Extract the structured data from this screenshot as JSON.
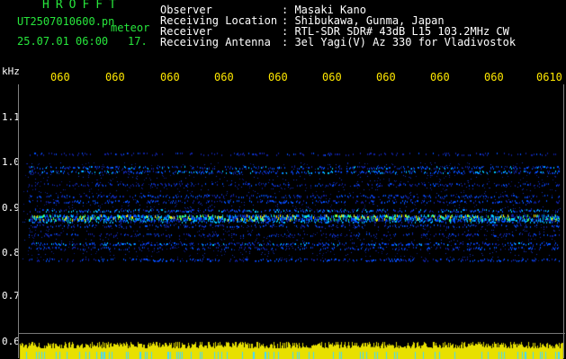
{
  "header": {
    "logo": "HROFFT",
    "filename": "UT2507010600.pn",
    "mode": "meteor",
    "datetime": "25.07.01 06:00",
    "count": "17.",
    "info": [
      {
        "label": "Observer",
        "value": ": Masaki Kano"
      },
      {
        "label": "Receiving Location",
        "value": ": Shibukawa, Gunma, Japan"
      },
      {
        "label": "Receiver",
        "value": ": RTL-SDR SDR# 43dB L15 103.2MHz CW"
      },
      {
        "label": "Receiving Antenna",
        "value": ": 3el Yagi(V) Az 330 for Vladivostok"
      }
    ]
  },
  "axes": {
    "y_unit": "kHz",
    "y_ticks": [
      "1.1",
      "1.0",
      "0.9",
      "0.8",
      "0.7",
      "0.6"
    ],
    "x_ticks": [
      "060",
      "060",
      "060",
      "060",
      "060",
      "060",
      "060",
      "060",
      "060",
      "060",
      "0610"
    ]
  },
  "colors": {
    "header_green": "#27e63c",
    "time_yellow": "#ffe800",
    "signal_band": "#00a0ff",
    "strong_signal": "#ffdd00",
    "noise_floor": "#e8e000"
  },
  "spectrogram": {
    "bands_khz": [
      1.02,
      0.99,
      0.98,
      0.953,
      0.925,
      0.915,
      0.895,
      0.883,
      0.877,
      0.87,
      0.86,
      0.84,
      0.82,
      0.81,
      0.785
    ]
  }
}
